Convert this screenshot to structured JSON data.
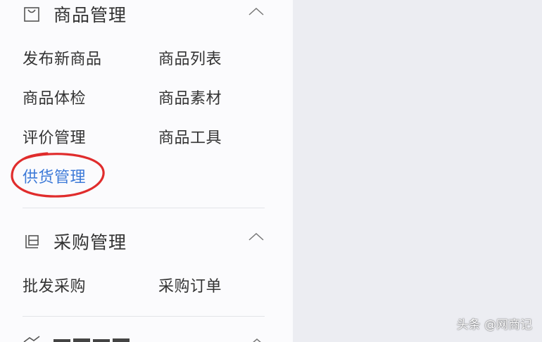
{
  "sections": [
    {
      "title": "商品管理",
      "icon": "shopping-bag-icon",
      "expanded": true,
      "items": [
        "发布新商品",
        "商品列表",
        "商品体检",
        "商品素材",
        "评价管理",
        "商品工具",
        "供货管理"
      ],
      "highlighted_item": "供货管理"
    },
    {
      "title": "采购管理",
      "icon": "calendar-icon",
      "expanded": true,
      "items": [
        "批发采购",
        "采购订单"
      ]
    }
  ],
  "watermark": "头条 @网商记",
  "colors": {
    "text": "#333333",
    "active_link": "#3d7ad8",
    "highlight_circle": "#e02c2c",
    "sidebar_bg": "#fbfbfd",
    "page_bg": "#ecedf2",
    "divider": "#e3e4e8"
  }
}
